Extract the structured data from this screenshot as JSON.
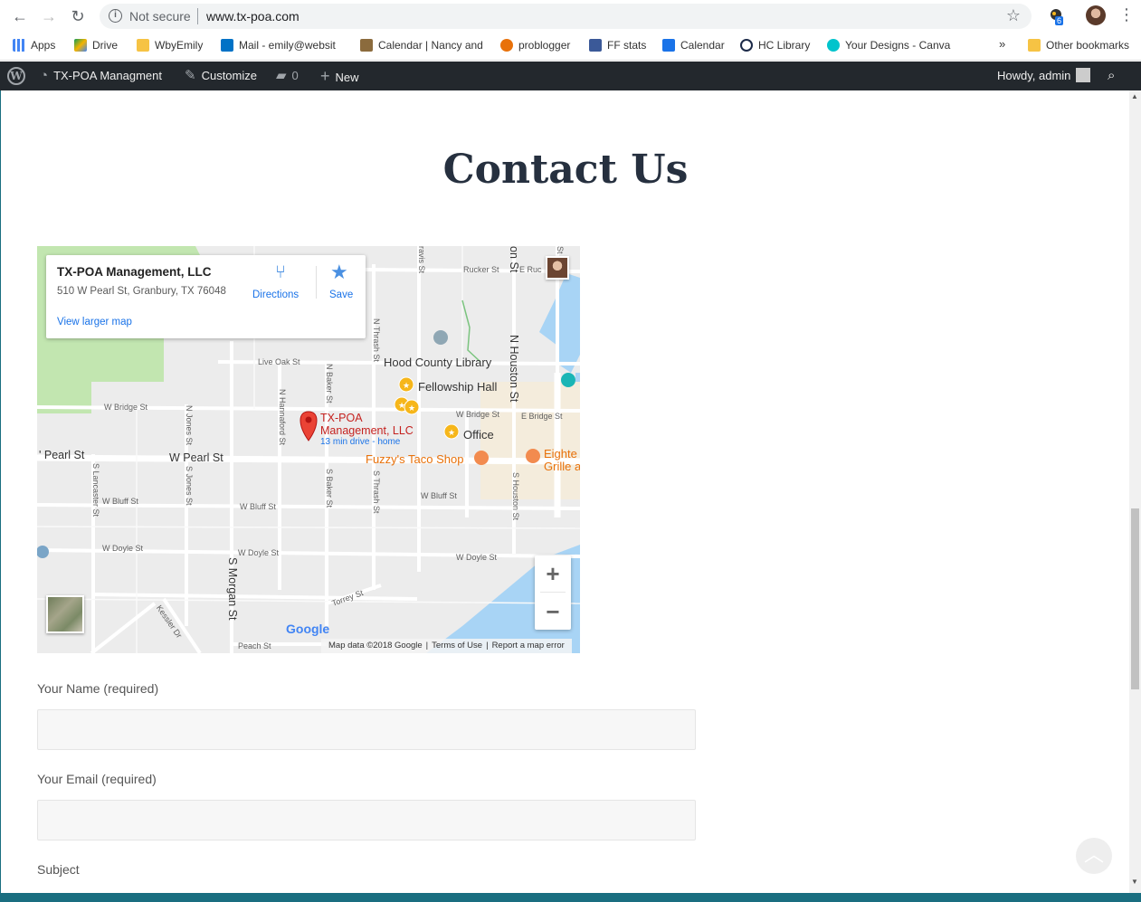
{
  "browser": {
    "security_label": "Not secure",
    "url": "www.tx-poa.com",
    "extension_badge": "6",
    "bookmarks": [
      {
        "label": "Apps",
        "color": "#4285f4"
      },
      {
        "label": "Drive",
        "color": "#0f9d58"
      },
      {
        "label": "WbyEmily",
        "color": "#f6c344"
      },
      {
        "label": "Mail - emily@websit",
        "color": "#0072c6"
      },
      {
        "label": "Calendar | Nancy and",
        "color": "#8b6b3d"
      },
      {
        "label": "problogger",
        "color": "#e8710a"
      },
      {
        "label": "FF stats",
        "color": "#3b5998"
      },
      {
        "label": "Calendar",
        "color": "#1a73e8"
      },
      {
        "label": "HC Library",
        "color": "#1c2a48"
      },
      {
        "label": "Your Designs - Canva",
        "color": "#00c4cc"
      }
    ],
    "more_bookmarks": "»",
    "other_bookmarks": "Other bookmarks"
  },
  "adminbar": {
    "site_name": "TX-POA Managment",
    "customize": "Customize",
    "comments_count": "0",
    "new_label": "New",
    "howdy": "Howdy, admin"
  },
  "page": {
    "title": "Contact Us"
  },
  "map": {
    "place_name": "TX-POA Management, LLC",
    "address": "510 W Pearl St, Granbury, TX 76048",
    "directions": "Directions",
    "save": "Save",
    "view_larger": "View larger map",
    "pin_label_1": "TX-POA",
    "pin_label_2": "Management, LLC",
    "drive_time": "13 min drive - home",
    "zoom_in": "+",
    "zoom_out": "−",
    "logo": "Google",
    "footer": {
      "map_data": "Map data ©2018 Google",
      "terms": "Terms of Use",
      "report": "Report a map error"
    },
    "poi": {
      "library": "Hood County Library",
      "fellowship": "Fellowship Hall",
      "office": "Office",
      "fuzzys": "Fuzzy's Taco Shop",
      "eighteen_1": "Eighte",
      "eighteen_2": "Grille a"
    },
    "streets": {
      "rucker": "Rucker St",
      "e_ruc": "E Ruc",
      "live_oak": "Live Oak St",
      "w_bridge": "W Bridge St",
      "w_bridge_2": "W Bridge St",
      "e_bridge": "E Bridge St",
      "w_pearl": "W Pearl St",
      "pearl_left": "' Pearl St",
      "w_bluff": "W Bluff St",
      "w_bluff_2": "W Bluff St",
      "w_bluff_3": "W Bluff St",
      "w_doyle": "W Doyle St",
      "w_doyle_2": "W Doyle St",
      "w_doyle_3": "W Doyle St",
      "torrey": "Torrey St",
      "peach": "Peach St",
      "n_thrash": "N Thrash St",
      "n_baker": "N Baker St",
      "n_hannaford": "N Hannaford St",
      "n_jones": "N Jones St",
      "n_houston": "N Houston St",
      "s_lancaster": "S Lancaster St",
      "s_jones": "S Jones St",
      "s_baker": "S Baker St",
      "s_thrash": "S Thrash St",
      "s_houston": "S Houston St",
      "s_morgan": "S Morgan St",
      "kessler": "Kessler Dr",
      "travis": "ravis St",
      "on_st": "on St",
      "st_top": "St"
    },
    "colors": {
      "water": "#a8d4f5",
      "park": "#c2e6b0",
      "road": "#ffffff",
      "pin": "#ea4335",
      "poi_yellow": "#f6b61a",
      "poi_orange": "#f28b4f"
    }
  },
  "form": {
    "name_label": "Your Name (required)",
    "email_label": "Your Email (required)",
    "subject_label": "Subject"
  }
}
